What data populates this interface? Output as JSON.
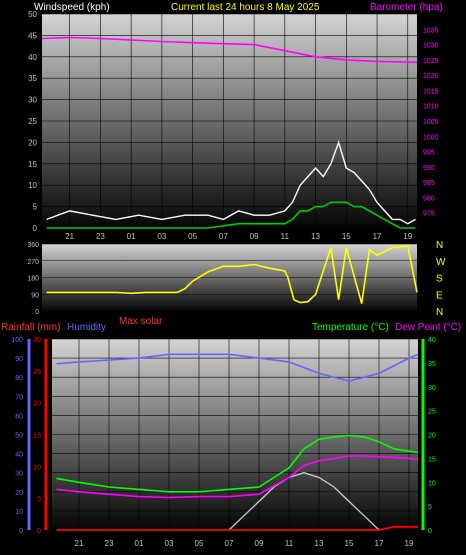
{
  "header": {
    "left": "Windspeed (kph)",
    "center": "Current last 24 hours 8 May 2025",
    "right": "Barometer (hpa)"
  },
  "colors": {
    "gust": "#ffffff",
    "average": "#00cc00",
    "barometer": "#ff00ff",
    "direction": "#ffff00",
    "rainfall": "#ff0000",
    "humidity": "#6666ff",
    "temperature": "#00ff00",
    "dewpoint": "#ff00ff",
    "solar": "#cccccc",
    "tickText": "#c0c0c0"
  },
  "chart_data": [
    {
      "type": "line",
      "title": "Current last 24 hours 8 May 2025",
      "ylabel": "Windspeed (kph)",
      "y2label": "Barometer (hpa)",
      "x_hours": [
        "21",
        "23",
        "01",
        "03",
        "05",
        "07",
        "09",
        "11",
        "13",
        "15",
        "17",
        "19"
      ],
      "x_range_hours": [
        19.2,
        43.6
      ],
      "ylim": [
        0,
        50
      ],
      "yticks": [
        0,
        5,
        10,
        15,
        20,
        25,
        30,
        35,
        40,
        45,
        50
      ],
      "y2lim": [
        970,
        1040
      ],
      "y2ticks": [
        975,
        980,
        985,
        990,
        995,
        1000,
        1005,
        1010,
        1015,
        1020,
        1025,
        1030,
        1035
      ],
      "series": [
        {
          "name": "Gust",
          "x": [
            19.5,
            21,
            22.5,
            24,
            25.5,
            27,
            28.5,
            30,
            31,
            32,
            33,
            34,
            35,
            35.5,
            36,
            36.5,
            37,
            37.5,
            38,
            38.5,
            39,
            39.5,
            40,
            40.5,
            41,
            41.5,
            42,
            42.5,
            43,
            43.5
          ],
          "y": [
            2,
            4,
            3,
            2,
            3,
            2,
            3,
            3,
            2,
            4,
            3,
            3,
            4,
            6,
            10,
            12,
            14,
            12,
            15,
            20,
            14,
            13,
            11,
            9,
            6,
            4,
            2,
            2,
            1,
            2
          ]
        },
        {
          "name": "Average",
          "x": [
            19.5,
            22,
            25,
            28,
            30,
            32,
            33,
            34,
            35,
            35.5,
            36,
            36.5,
            37,
            37.5,
            38,
            38.5,
            39,
            39.5,
            40,
            40.5,
            41,
            41.5,
            42,
            42.5,
            43,
            43.5
          ],
          "y": [
            0,
            0,
            0,
            0,
            0,
            1,
            1,
            1,
            1,
            2,
            4,
            4,
            5,
            5,
            6,
            6,
            6,
            5,
            5,
            4,
            3,
            2,
            1,
            0,
            0,
            0
          ]
        },
        {
          "name": "Barometer",
          "axis": "y2",
          "x": [
            19.2,
            21,
            23,
            25,
            27,
            29,
            31,
            33,
            35,
            37,
            39,
            41,
            43.6
          ],
          "y": [
            1032,
            1032.3,
            1032,
            1031.5,
            1031,
            1030.6,
            1030.3,
            1030,
            1028,
            1026,
            1025,
            1024.5,
            1024.2
          ]
        }
      ]
    },
    {
      "type": "line",
      "ylabel": "Wind direction",
      "ylim": [
        0,
        360
      ],
      "yticks": [
        0,
        90,
        180,
        270,
        360
      ],
      "compass": [
        "N",
        "W",
        "S",
        "E",
        "N"
      ],
      "series": [
        {
          "name": "Direction",
          "x": [
            19.5,
            22,
            24,
            25,
            26,
            27,
            28,
            28.5,
            29,
            30,
            31,
            32,
            33,
            34,
            35,
            35.2,
            35.6,
            36,
            36.5,
            37,
            38,
            38.5,
            39,
            40,
            40.5,
            41,
            42,
            43,
            43.6
          ],
          "y": [
            100,
            100,
            100,
            95,
            100,
            100,
            100,
            120,
            160,
            210,
            240,
            240,
            250,
            230,
            215,
            180,
            60,
            45,
            50,
            90,
            340,
            60,
            340,
            40,
            330,
            300,
            340,
            350,
            100
          ]
        }
      ]
    },
    {
      "type": "line",
      "legend": [
        "Rainfall (mm)",
        "Humidity",
        "Max solar",
        "Temperature (°C)",
        "Dew Point (°C)"
      ],
      "ylabel_humidity": "Humidity",
      "ylim_humidity": [
        0,
        100
      ],
      "yticks_humidity": [
        0,
        10,
        20,
        30,
        40,
        50,
        60,
        70,
        80,
        90,
        100
      ],
      "ylim_rainfall": [
        0,
        30
      ],
      "yticks_rainfall": [
        0,
        5,
        10,
        15,
        20,
        25,
        30
      ],
      "ylim_temperature": [
        0,
        40
      ],
      "yticks_temperature": [
        0,
        5,
        10,
        15,
        20,
        25,
        30,
        35,
        40
      ],
      "series": [
        {
          "name": "Humidity",
          "x": [
            19.5,
            21,
            23,
            25,
            27,
            29,
            31,
            33,
            35,
            36,
            37,
            39,
            41,
            43,
            43.6
          ],
          "y": [
            87,
            88,
            89,
            90,
            92,
            92,
            92,
            90,
            88,
            85,
            82,
            78,
            82,
            90,
            92
          ]
        },
        {
          "name": "Temperature (°C)",
          "x": [
            19.5,
            21,
            23,
            25,
            27,
            29,
            31,
            33,
            35,
            36,
            37,
            38,
            39,
            40,
            41,
            42,
            43,
            43.6
          ],
          "y": [
            10.8,
            10,
            9,
            8.5,
            8,
            8,
            8.5,
            9,
            13,
            17,
            19,
            19.5,
            19.8,
            19.5,
            18.5,
            17,
            16.5,
            16.2
          ]
        },
        {
          "name": "Dew Point (°C)",
          "x": [
            19.5,
            21,
            23,
            25,
            27,
            29,
            31,
            33,
            35,
            36,
            37,
            38,
            39,
            40,
            41,
            42,
            43,
            43.6
          ],
          "y": [
            8.5,
            8,
            7.5,
            7,
            6.8,
            7,
            7,
            7.5,
            11,
            13.5,
            14.5,
            15,
            15.5,
            15.5,
            15.3,
            15.2,
            15,
            14.8
          ]
        },
        {
          "name": "Rainfall (mm)",
          "x": [
            19.5,
            41,
            42,
            43.6
          ],
          "y": [
            0,
            0,
            0.5,
            0.5
          ]
        },
        {
          "name": "Max solar",
          "x": [
            31,
            32,
            33,
            34,
            35,
            36,
            37,
            38,
            39,
            40,
            41
          ],
          "y": [
            0,
            3,
            6,
            9,
            11,
            12,
            11,
            9,
            6,
            3,
            0
          ]
        }
      ]
    }
  ]
}
